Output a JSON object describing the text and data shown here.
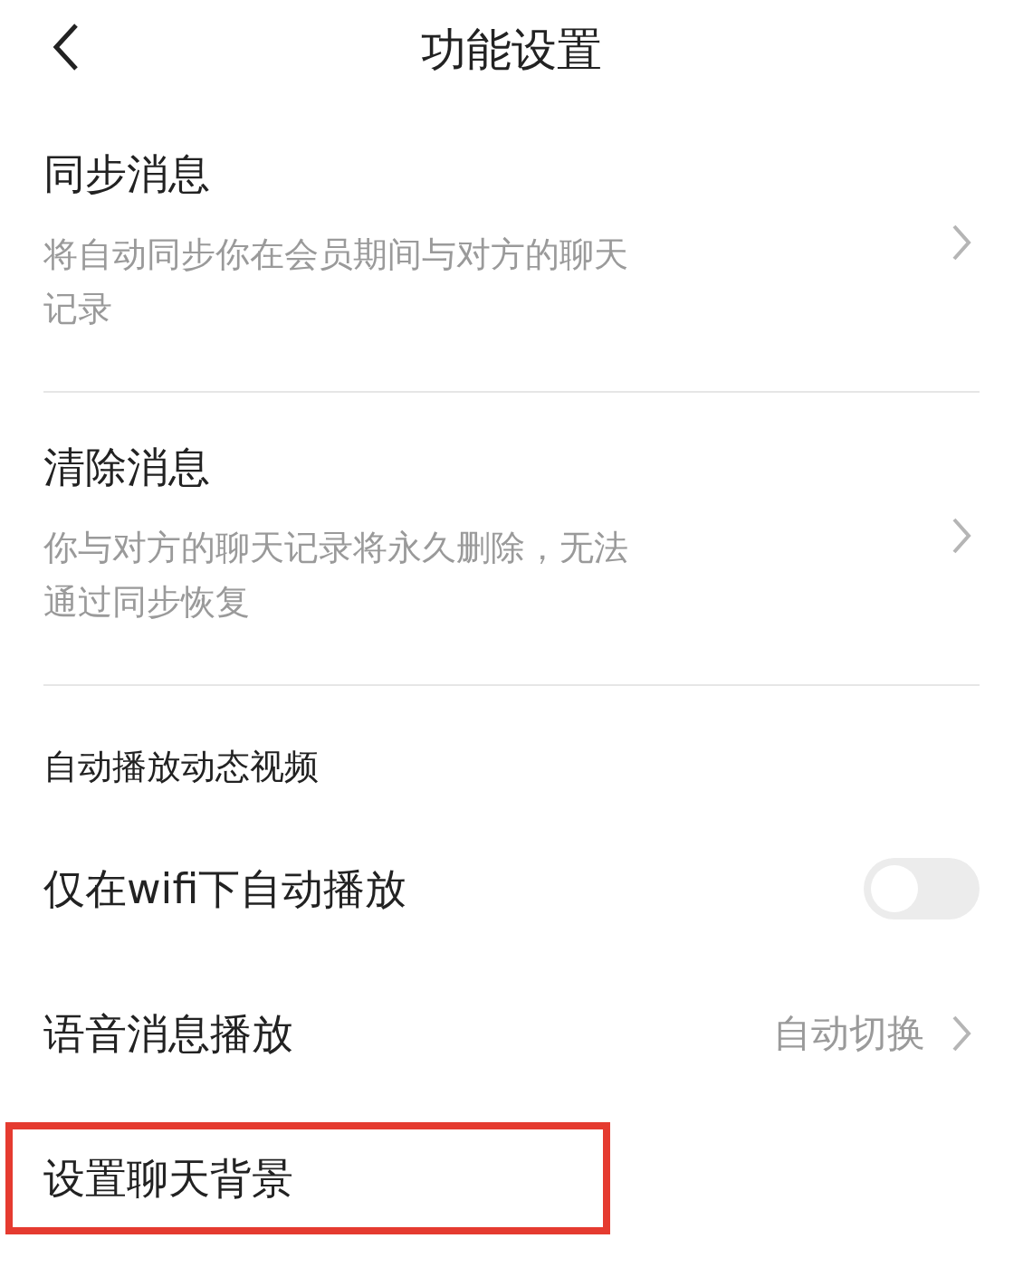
{
  "header": {
    "title": "功能设置"
  },
  "items": [
    {
      "kind": "link",
      "title": "同步消息",
      "description": "将自动同步你在会员期间与对方的聊天记录"
    },
    {
      "kind": "link",
      "title": "清除消息",
      "description": "你与对方的聊天记录将永久删除，无法通过同步恢复"
    }
  ],
  "section": {
    "title": "自动播放动态视频",
    "rows": [
      {
        "kind": "toggle",
        "label": "仅在wifi下自动播放",
        "on": false,
        "highlighted": false
      },
      {
        "kind": "value",
        "label": "语音消息播放",
        "value": "自动切换",
        "highlighted": false
      },
      {
        "kind": "plain",
        "label": "设置聊天背景",
        "highlighted": true
      }
    ]
  }
}
